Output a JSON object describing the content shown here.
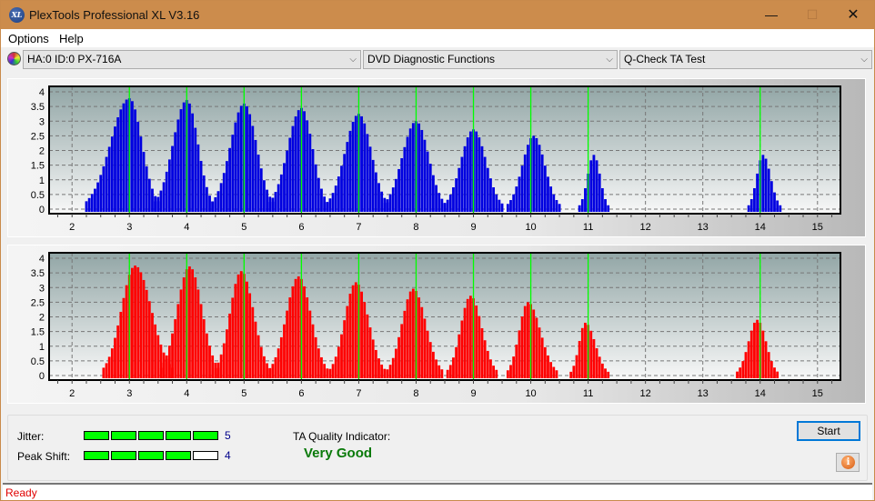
{
  "window": {
    "title": "PlexTools Professional XL V3.16",
    "app_icon": "XL",
    "controls": {
      "minimize": "—",
      "maximize": "☐",
      "close": "✕"
    }
  },
  "menu": [
    {
      "label": "Options"
    },
    {
      "label": "Help"
    }
  ],
  "toolbar": {
    "drive_icon": "disc-icon",
    "drive": "HA:0 ID:0  PX-716A",
    "function": "DVD Diagnostic Functions",
    "test": "Q-Check TA Test",
    "dropdown_arrow": "⌵"
  },
  "colors": {
    "titlebar": "#cc8c4c",
    "land_bars": "#0000e0",
    "pit_bars": "#ff0000",
    "reference_lines": "#00ff00",
    "quality_text": "#0a7a0a",
    "status_text": "#e00000"
  },
  "chart_data": [
    {
      "type": "bar",
      "name": "TA histogram (top, blue)",
      "xlabel": "",
      "ylabel": "",
      "xlim": [
        1.6,
        15.4
      ],
      "ylim": [
        0,
        4.1
      ],
      "x_ticks": [
        "2",
        "3",
        "4",
        "5",
        "6",
        "7",
        "8",
        "9",
        "10",
        "11",
        "12",
        "13",
        "14",
        "15"
      ],
      "y_ticks": [
        "0",
        "0.5",
        "1",
        "1.5",
        "2",
        "2.5",
        "3",
        "3.5",
        "4"
      ],
      "reference_lines_x": [
        3,
        4,
        5,
        6,
        7,
        8,
        9,
        10,
        11,
        14
      ],
      "grid": true,
      "peaks": [
        {
          "center": 3.0,
          "start": 2.25,
          "end": 3.5,
          "peak": 3.78
        },
        {
          "center": 4.0,
          "start": 3.45,
          "end": 4.45,
          "peak": 3.72
        },
        {
          "center": 5.0,
          "start": 4.45,
          "end": 5.5,
          "peak": 3.6
        },
        {
          "center": 6.0,
          "start": 5.45,
          "end": 6.45,
          "peak": 3.45
        },
        {
          "center": 7.0,
          "start": 6.45,
          "end": 7.5,
          "peak": 3.25
        },
        {
          "center": 8.0,
          "start": 7.45,
          "end": 8.5,
          "peak": 3.0
        },
        {
          "center": 9.0,
          "start": 8.5,
          "end": 9.5,
          "peak": 2.72
        },
        {
          "center": 10.05,
          "start": 9.6,
          "end": 10.5,
          "peak": 2.5
        },
        {
          "center": 11.1,
          "start": 10.85,
          "end": 11.35,
          "peak": 1.85
        },
        {
          "center": 14.05,
          "start": 13.8,
          "end": 14.35,
          "peak": 1.85
        }
      ]
    },
    {
      "type": "bar",
      "name": "TA histogram (bottom, red)",
      "xlabel": "",
      "ylabel": "",
      "xlim": [
        1.6,
        15.4
      ],
      "ylim": [
        0,
        4.1
      ],
      "x_ticks": [
        "2",
        "3",
        "4",
        "5",
        "6",
        "7",
        "8",
        "9",
        "10",
        "11",
        "12",
        "13",
        "14",
        "15"
      ],
      "y_ticks": [
        "0",
        "0.5",
        "1",
        "1.5",
        "2",
        "2.5",
        "3",
        "3.5",
        "4"
      ],
      "reference_lines_x": [
        3,
        4,
        5,
        6,
        7,
        8,
        9,
        10,
        11,
        14
      ],
      "grid": true,
      "peaks": [
        {
          "center": 3.1,
          "start": 2.55,
          "end": 3.75,
          "peak": 3.75
        },
        {
          "center": 4.05,
          "start": 3.55,
          "end": 4.55,
          "peak": 3.72
        },
        {
          "center": 4.95,
          "start": 4.5,
          "end": 5.45,
          "peak": 3.56
        },
        {
          "center": 5.95,
          "start": 5.45,
          "end": 6.45,
          "peak": 3.38
        },
        {
          "center": 6.95,
          "start": 6.5,
          "end": 7.45,
          "peak": 3.18
        },
        {
          "center": 7.95,
          "start": 7.5,
          "end": 8.45,
          "peak": 2.96
        },
        {
          "center": 8.95,
          "start": 8.55,
          "end": 9.4,
          "peak": 2.72
        },
        {
          "center": 9.95,
          "start": 9.6,
          "end": 10.45,
          "peak": 2.5
        },
        {
          "center": 10.95,
          "start": 10.7,
          "end": 11.35,
          "peak": 1.8
        },
        {
          "center": 13.95,
          "start": 13.6,
          "end": 14.3,
          "peak": 1.9
        }
      ]
    }
  ],
  "results": {
    "jitter_label": "Jitter:",
    "jitter_score": "5",
    "jitter_max": 5,
    "peak_shift_label": "Peak Shift:",
    "peak_shift_score": "4",
    "peak_shift_max": 5,
    "ta_quality_label": "TA Quality Indicator:",
    "ta_quality_value": "Very Good"
  },
  "buttons": {
    "start": "Start",
    "info": "i"
  },
  "status": "Ready"
}
